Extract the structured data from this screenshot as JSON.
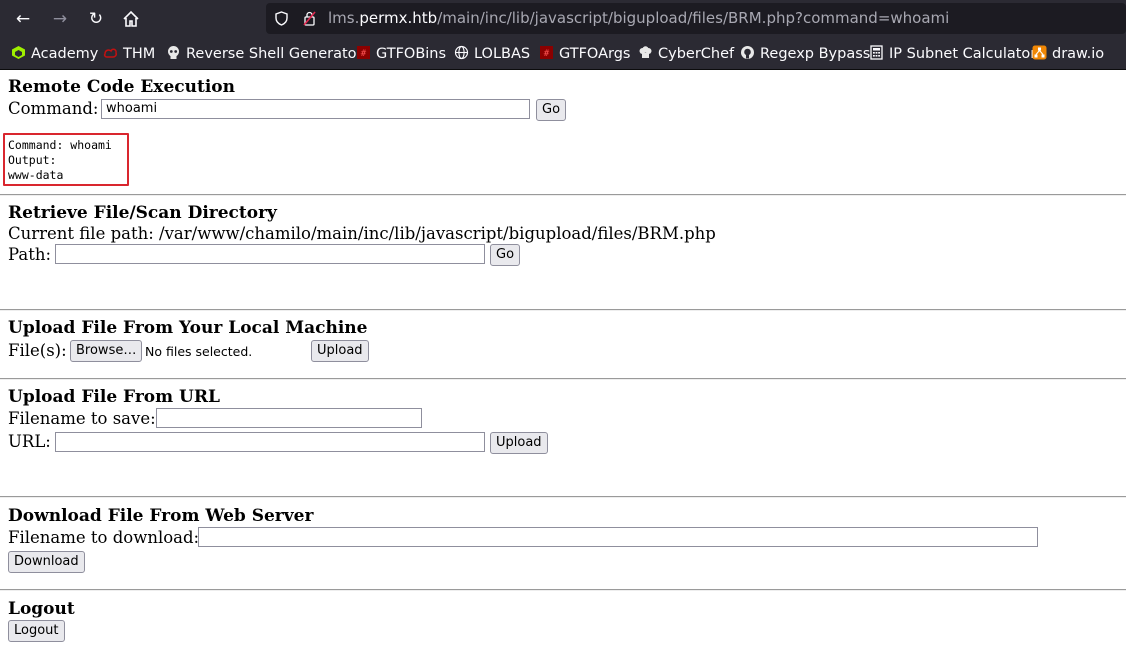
{
  "browser": {
    "url_host": "lms.permx.htb",
    "url_path": "/main/inc/lib/javascript/bigupload/files/BRM.php?command=whoami",
    "url_prefix": "lms.",
    "url_domain": "permx.htb",
    "bookmarks": [
      "Academy",
      "THM",
      "Reverse Shell Generator",
      "GTFOBins",
      "LOLBAS",
      "GTFOArgs",
      "CyberChef",
      "Regexp Bypass",
      "IP Subnet Calculator",
      "draw.io"
    ]
  },
  "rce": {
    "heading": "Remote Code Execution",
    "command_label": "Command:",
    "command_value": "whoami",
    "go_label": "Go",
    "output_line1": "Command: whoami",
    "output_line2": "Output:",
    "output_line3": "www-data"
  },
  "retrieve": {
    "heading": "Retrieve File/Scan Directory",
    "current_path": "Current file path: /var/www/chamilo/main/inc/lib/javascript/bigupload/files/BRM.php",
    "path_label": "Path:",
    "go_label": "Go"
  },
  "upload_local": {
    "heading": "Upload File From Your Local Machine",
    "files_label": "File(s):",
    "browse_label": "Browse…",
    "no_files": "No files selected.",
    "upload_label": "Upload"
  },
  "upload_url": {
    "heading": "Upload File From URL",
    "filename_label": "Filename to save:",
    "url_label": "URL:",
    "upload_label": "Upload"
  },
  "download": {
    "heading": "Download File From Web Server",
    "filename_label": "Filename to download:",
    "download_label": "Download"
  },
  "logout": {
    "heading": "Logout",
    "logout_label": "Logout"
  },
  "colors": {
    "chrome_bg": "#2b2a33",
    "urlbar_bg": "#1c1b22",
    "highlight_box": "#d9262e"
  }
}
